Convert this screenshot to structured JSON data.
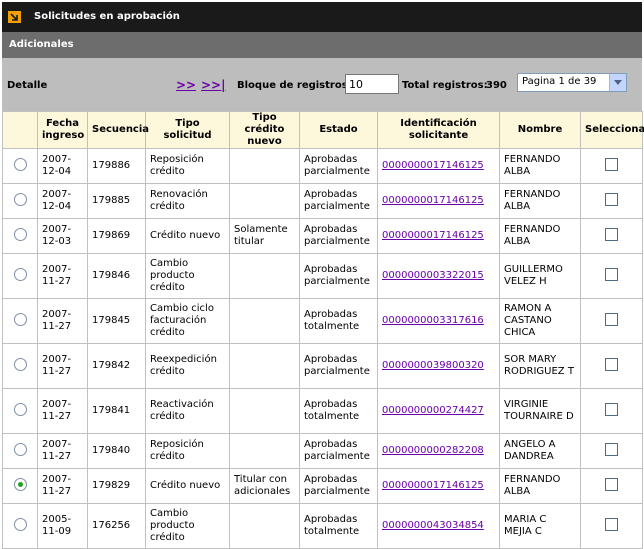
{
  "header": {
    "title": "Solicitudes en aprobación",
    "subtitle": "Adicionales"
  },
  "toolbar": {
    "detail_label": "Detalle",
    "next_link": ">>",
    "last_link": ">>|",
    "block_label": "Bloque de registros:",
    "block_value": "10",
    "total_label": "Total registros:",
    "total_value": "390",
    "page_select": "Pagina 1 de 39"
  },
  "table": {
    "headers": [
      "",
      "Fecha ingreso",
      "Secuencia",
      "Tipo solicitud",
      "Tipo crédito nuevo",
      "Estado",
      "Identificación solicitante",
      "Nombre",
      "Seleccionar"
    ],
    "rows": [
      {
        "fecha": "2007-12-04",
        "secuencia": "179886",
        "tipo": "Reposición crédito",
        "credito": "",
        "estado": "Aprobadas parcialmente",
        "id": "0000000017146125",
        "nombre": "FERNANDO ALBA",
        "selected": false
      },
      {
        "fecha": "2007-12-04",
        "secuencia": "179885",
        "tipo": "Renovación crédito",
        "credito": "",
        "estado": "Aprobadas parcialmente",
        "id": "0000000017146125",
        "nombre": "FERNANDO ALBA",
        "selected": false
      },
      {
        "fecha": "2007-12-03",
        "secuencia": "179869",
        "tipo": "Crédito nuevo",
        "credito": "Solamente titular",
        "estado": "Aprobadas parcialmente",
        "id": "0000000017146125",
        "nombre": "FERNANDO ALBA",
        "selected": false
      },
      {
        "fecha": "2007-11-27",
        "secuencia": "179846",
        "tipo": "Cambio producto crédito",
        "credito": "",
        "estado": "Aprobadas parcialmente",
        "id": "0000000003322015",
        "nombre": "GUILLERMO VELEZ H",
        "selected": false
      },
      {
        "fecha": "2007-11-27",
        "secuencia": "179845",
        "tipo": "Cambio ciclo facturación crédito",
        "credito": "",
        "estado": "Aprobadas totalmente",
        "id": "0000000003317616",
        "nombre": "RAMON A CASTANO CHICA",
        "selected": false
      },
      {
        "fecha": "2007-11-27",
        "secuencia": "179842",
        "tipo": "Reexpedición crédito",
        "credito": "",
        "estado": "Aprobadas parcialmente",
        "id": "0000000039800320",
        "nombre": "SOR MARY RODRIGUEZ T",
        "selected": false
      },
      {
        "fecha": "2007-11-27",
        "secuencia": "179841",
        "tipo": "Reactivación crédito",
        "credito": "",
        "estado": "Aprobadas totalmente",
        "id": "0000000000274427",
        "nombre": "VIRGINIE TOURNAIRE D",
        "selected": false
      },
      {
        "fecha": "2007-11-27",
        "secuencia": "179840",
        "tipo": "Reposición crédito",
        "credito": "",
        "estado": "Aprobadas parcialmente",
        "id": "0000000000282208",
        "nombre": "ANGELO A DANDREA",
        "selected": false
      },
      {
        "fecha": "2007-11-27",
        "secuencia": "179829",
        "tipo": "Crédito nuevo",
        "credito": "Titular con adicionales",
        "estado": "Aprobadas parcialmente",
        "id": "0000000017146125",
        "nombre": "FERNANDO ALBA",
        "selected": true
      },
      {
        "fecha": "2005-11-09",
        "secuencia": "176256",
        "tipo": "Cambio producto crédito",
        "credito": "",
        "estado": "Aprobadas totalmente",
        "id": "0000000043034854",
        "nombre": "MARIA C MEJIA C",
        "selected": false
      }
    ]
  }
}
